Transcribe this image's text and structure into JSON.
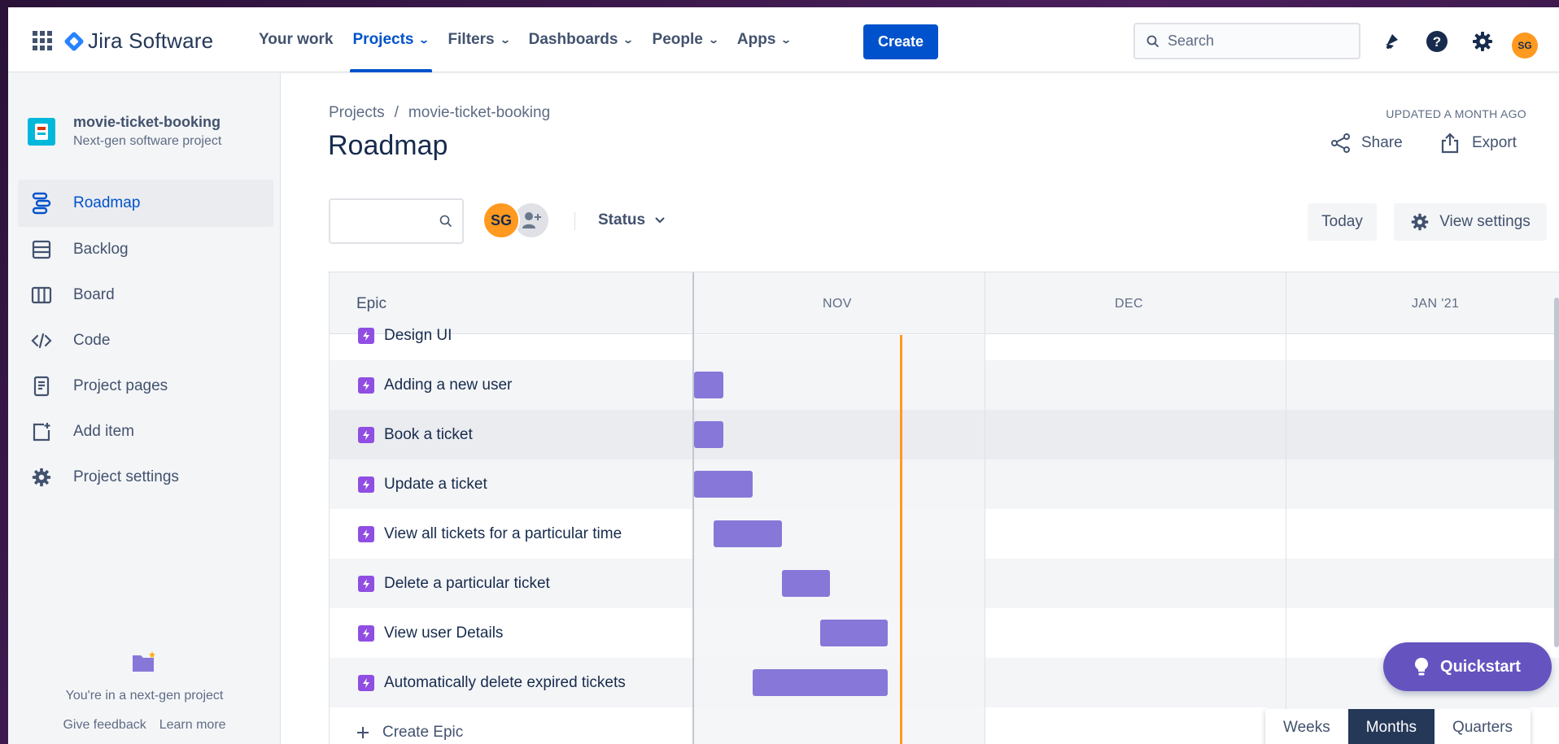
{
  "topnav": {
    "product": "Jira Software",
    "items": [
      {
        "label": "Your work",
        "chevron": false,
        "active": false
      },
      {
        "label": "Projects",
        "chevron": true,
        "active": true
      },
      {
        "label": "Filters",
        "chevron": true,
        "active": false
      },
      {
        "label": "Dashboards",
        "chevron": true,
        "active": false
      },
      {
        "label": "People",
        "chevron": true,
        "active": false
      },
      {
        "label": "Apps",
        "chevron": true,
        "active": false
      }
    ],
    "create_label": "Create",
    "search_placeholder": "Search",
    "avatar_initials": "SG",
    "icons": [
      "notifications-icon",
      "help-icon",
      "settings-icon"
    ]
  },
  "sidebar": {
    "project_name": "movie-ticket-booking",
    "project_type": "Next-gen software project",
    "items": [
      {
        "label": "Roadmap",
        "icon": "roadmap-icon",
        "active": true
      },
      {
        "label": "Backlog",
        "icon": "backlog-icon",
        "active": false
      },
      {
        "label": "Board",
        "icon": "board-icon",
        "active": false
      },
      {
        "label": "Code",
        "icon": "code-icon",
        "active": false
      },
      {
        "label": "Project pages",
        "icon": "pages-icon",
        "active": false
      },
      {
        "label": "Add item",
        "icon": "add-item-icon",
        "active": false
      },
      {
        "label": "Project settings",
        "icon": "gear-icon",
        "active": false
      }
    ],
    "footer_note": "You're in a next-gen project",
    "footer_links": [
      "Give feedback",
      "Learn more"
    ]
  },
  "main": {
    "breadcrumb": [
      "Projects",
      "/",
      "movie-ticket-booking"
    ],
    "title": "Roadmap",
    "updated": "UPDATED A MONTH AGO",
    "share_label": "Share",
    "export_label": "Export",
    "status_filter": "Status",
    "avatar_initials": "SG",
    "today_label": "Today",
    "view_settings_label": "View settings"
  },
  "roadmap": {
    "epic_header": "Epic",
    "months": [
      "NOV",
      "DEC",
      "JAN '21"
    ],
    "epics": [
      {
        "label": "Design UI"
      },
      {
        "label": "Adding a new user"
      },
      {
        "label": "Book a ticket"
      },
      {
        "label": "Update a ticket"
      },
      {
        "label": "View all tickets for a particular time"
      },
      {
        "label": "Delete a particular ticket"
      },
      {
        "label": "View user Details"
      },
      {
        "label": "Automatically delete expired tickets"
      }
    ],
    "create_epic_label": "Create Epic"
  },
  "quickstart_label": "Quickstart",
  "zoom": {
    "options": [
      "Weeks",
      "Months",
      "Quarters"
    ],
    "selected": "Months"
  },
  "colors": {
    "primary": "#0052CC",
    "epic_bar": "#8777D9",
    "epic_icon": "#904EE2",
    "today_line": "#FF991F",
    "quickstart": "#6554C0"
  }
}
